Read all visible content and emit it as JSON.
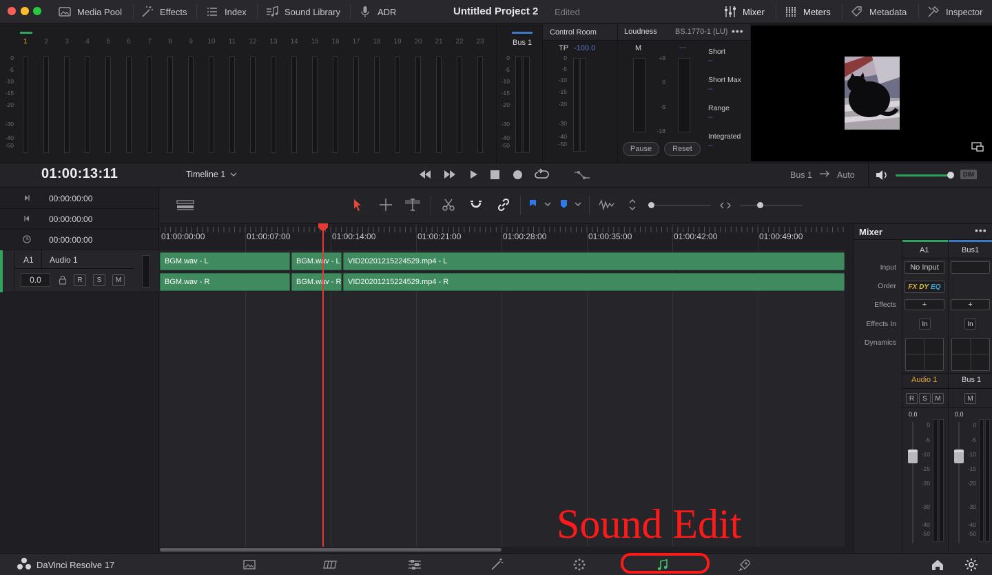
{
  "topbar": {
    "media_pool": "Media Pool",
    "effects": "Effects",
    "index": "Index",
    "sound_library": "Sound Library",
    "adr": "ADR",
    "project_title": "Untitled Project 2",
    "edited": "Edited",
    "mixer": "Mixer",
    "meters": "Meters",
    "metadata": "Metadata",
    "inspector": "Inspector"
  },
  "meters": {
    "channels": [
      "1",
      "2",
      "3",
      "4",
      "5",
      "6",
      "7",
      "8",
      "9",
      "10",
      "11",
      "12",
      "13",
      "14",
      "15",
      "16",
      "17",
      "18",
      "19",
      "20",
      "21",
      "22",
      "23"
    ],
    "scale": [
      "0",
      "-5",
      "-10",
      "-15",
      "-20",
      "-30",
      "-40",
      "-50"
    ],
    "bus_label": "Bus 1",
    "control_room": "Control Room",
    "tp_label": "TP",
    "tp_value": "-100.0",
    "loudness_title": "Loudness",
    "loudness_standard": "BS.1770-1 (LU)",
    "m_label": "M",
    "m_dash": "---",
    "loud_scale": [
      "+9",
      "0",
      "-9",
      "-18"
    ],
    "short": "Short",
    "short_max": "Short Max",
    "range": "Range",
    "integrated": "Integrated",
    "dash": "--",
    "pause": "Pause",
    "reset": "Reset"
  },
  "transport": {
    "timecode": "01:00:13:11",
    "timeline_name": "Timeline 1",
    "bus_output": "Bus 1",
    "auto": "Auto",
    "dim": "DIM"
  },
  "left_panel": {
    "tc_in": "00:00:00:00",
    "tc_out": "00:00:00:00",
    "tc_dur": "00:00:00:00",
    "track_id": "A1",
    "track_name": "Audio 1",
    "track_volume": "0.0",
    "r": "R",
    "s": "S",
    "m": "M"
  },
  "ruler": {
    "labels": [
      "01:00:00:00",
      "01:00:07:00",
      "01:00:14:00",
      "01:00:21:00",
      "01:00:28:00",
      "01:00:35:00",
      "01:00:42:00",
      "01:00:49:00"
    ]
  },
  "clips": {
    "bgm_l": "BGM.wav - L",
    "bgm_r": "BGM.wav - R",
    "bgm_l2": "BGM.wav - L",
    "bgm_r2": "BGM.wav - R",
    "vid_l": "VID20201215224529.mp4 - L",
    "vid_r": "VID20201215224529.mp4 - R"
  },
  "mixer": {
    "title": "Mixer",
    "col_a1": "A1",
    "col_bus1": "Bus1",
    "input": "Input",
    "order": "Order",
    "effects": "Effects",
    "effects_in": "Effects In",
    "dynamics": "Dynamics",
    "no_input": "No Input",
    "fx": "FX",
    "dy": "DY",
    "eq": "EQ",
    "plus": "+",
    "in": "In",
    "audio1": "Audio 1",
    "bus1_name": "Bus 1",
    "r": "R",
    "s": "S",
    "m": "M",
    "bus_m": "M",
    "fader_a1": "0.0",
    "fader_bus": "0.0",
    "fader_scale": [
      "0",
      "-5",
      "-10",
      "-15",
      "-20",
      "-30",
      "-40",
      "-50"
    ]
  },
  "bottombar": {
    "app_name": "DaVinci Resolve 17"
  },
  "annotation": {
    "text": "Sound Edit"
  },
  "colors": {
    "clip_green": "#3f8a5e",
    "playhead_red": "#e53935",
    "annotation_red": "#ff1a1a",
    "accent_green": "#2fa45f",
    "loud_blue": "#5b78c8"
  }
}
